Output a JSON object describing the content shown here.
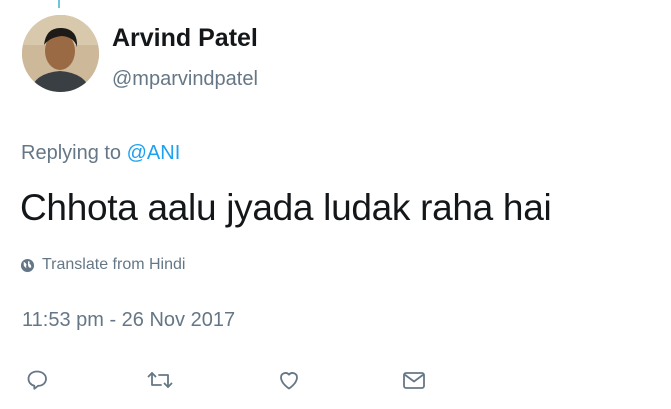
{
  "author": {
    "name": "Arvind Patel",
    "handle": "@mparvindpatel",
    "avatar_icon": "user-avatar-photo"
  },
  "reply": {
    "prefix": "Replying to",
    "mention": "@ANI"
  },
  "tweet": {
    "text": "Chhota aalu jyada ludak raha hai",
    "translate_label": "Translate from Hindi",
    "timestamp": "11:53 pm - 26 Nov 2017"
  },
  "actions": [
    {
      "icon": "reply-icon"
    },
    {
      "icon": "retweet-icon"
    },
    {
      "icon": "like-heart-icon"
    },
    {
      "icon": "direct-message-icon"
    }
  ],
  "colors": {
    "text": "#14171a",
    "secondary": "#657786",
    "link": "#1da1f2"
  }
}
